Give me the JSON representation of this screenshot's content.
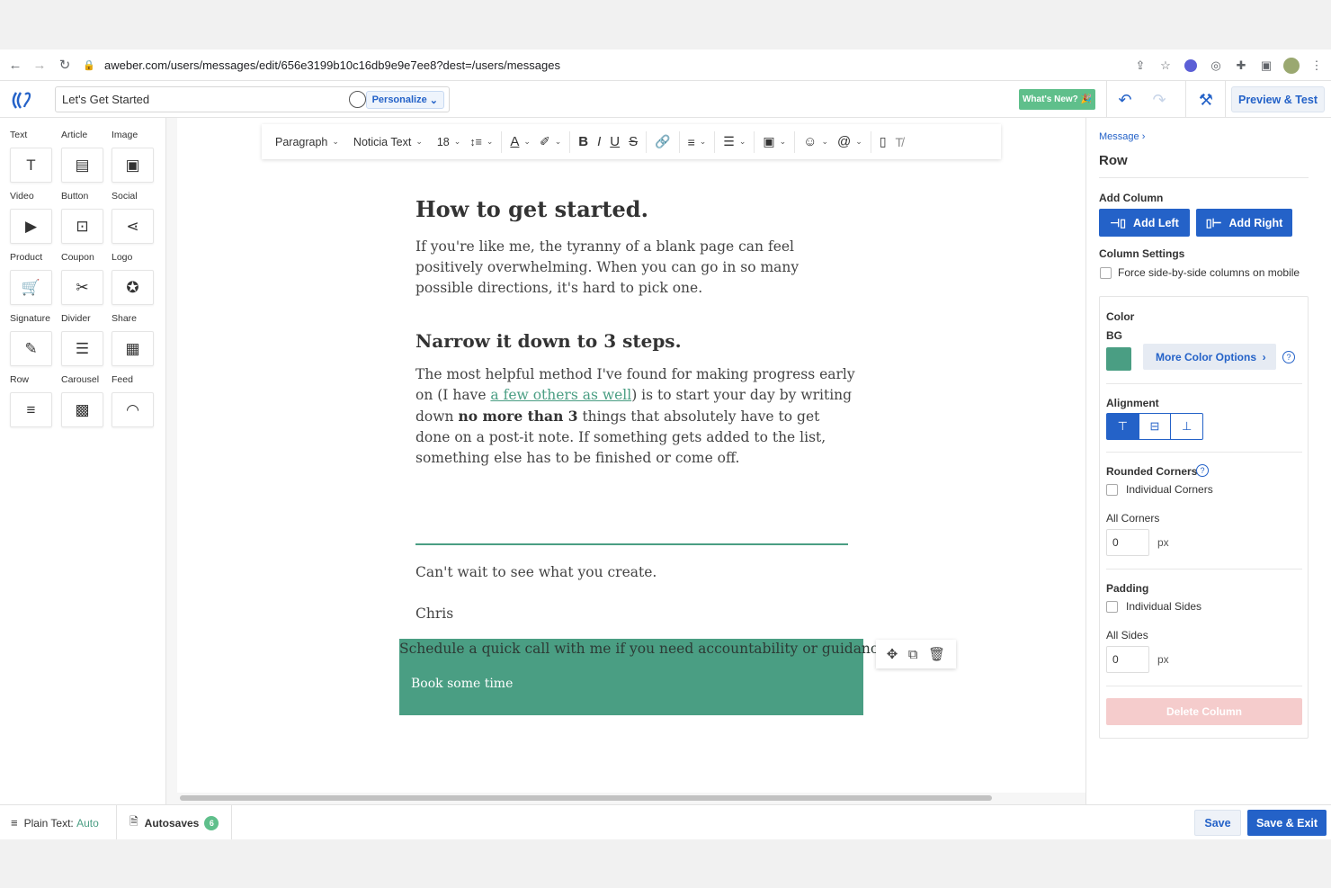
{
  "browser": {
    "url": "aweber.com/users/messages/edit/656e3199b10c16db9e9e7ee8?dest=/users/messages"
  },
  "appbar": {
    "subject_value": "Let's Get Started",
    "personalize_label": "Personalize",
    "whats_new_label": "What's New?",
    "preview_label": "Preview & Test"
  },
  "blocks": [
    {
      "label": "Text",
      "icon": "text-icon",
      "glyph": "T"
    },
    {
      "label": "Article",
      "icon": "article-icon",
      "glyph": "▤"
    },
    {
      "label": "Image",
      "icon": "image-icon",
      "glyph": "▣"
    },
    {
      "label": "Video",
      "icon": "video-icon",
      "glyph": "▶"
    },
    {
      "label": "Button",
      "icon": "button-icon",
      "glyph": "⊡"
    },
    {
      "label": "Social",
      "icon": "social-icon",
      "glyph": "⋖"
    },
    {
      "label": "Product",
      "icon": "product-icon",
      "glyph": "🛒"
    },
    {
      "label": "Coupon",
      "icon": "coupon-icon",
      "glyph": "✂"
    },
    {
      "label": "Logo",
      "icon": "logo-icon",
      "glyph": "✪"
    },
    {
      "label": "Signature",
      "icon": "signature-icon",
      "glyph": "✎"
    },
    {
      "label": "Divider",
      "icon": "divider-icon",
      "glyph": "☰"
    },
    {
      "label": "Share",
      "icon": "share-icon",
      "glyph": "▦"
    },
    {
      "label": "Row",
      "icon": "row-icon",
      "glyph": "≡"
    },
    {
      "label": "Carousel",
      "icon": "carousel-icon",
      "glyph": "▩"
    },
    {
      "label": "Feed",
      "icon": "feed-icon",
      "glyph": "◠"
    }
  ],
  "toolbar": {
    "paragraph": "Paragraph",
    "font": "Noticia Text",
    "size": "18"
  },
  "content": {
    "heading1": "How to get started.",
    "para1": "If you're like me, the tyranny of a blank page can feel positively overwhelming. When you can go in so many possible directions, it's hard to pick one.",
    "heading2": "Narrow it down to 3 steps.",
    "para2_a": "The most helpful method I've found for making progress early on (I have ",
    "para2_link": "a few others as well",
    "para2_b": ") is to start your day by writing down ",
    "para2_bold": "no more than 3",
    "para2_c": " things that absolutely have to get done on a post-it note. If something gets added to the list, something else has to be finished or come off.",
    "closing": "Can't wait to see what you create.",
    "signature": "Chris",
    "row_text": "Schedule a quick call with me if you need accountability or guidance.",
    "row_button": "Book some time"
  },
  "panel": {
    "breadcrumb": "Message",
    "title": "Row",
    "add_column_label": "Add Column",
    "add_left": "Add Left",
    "add_right": "Add Right",
    "column_settings": "Column Settings",
    "force_side_by_side": "Force side-by-side columns on mobile",
    "color_label": "Color",
    "bg_label": "BG",
    "bg_color": "#4a9e83",
    "more_color_options": "More Color Options",
    "alignment_label": "Alignment",
    "rounded_corners": "Rounded Corners",
    "individual_corners": "Individual Corners",
    "all_corners": "All Corners",
    "all_corners_value": "0",
    "px": "px",
    "padding_label": "Padding",
    "individual_sides": "Individual Sides",
    "all_sides": "All Sides",
    "all_sides_value": "0",
    "delete_column": "Delete Column"
  },
  "footer": {
    "plain_text_label": "Plain Text:",
    "plain_text_value": "Auto",
    "autosaves_label": "Autosaves",
    "autosaves_count": "6",
    "save": "Save",
    "save_exit": "Save & Exit"
  },
  "colors": {
    "accent": "#2462c8",
    "green": "#4a9e83",
    "whats_new": "#5fbf8b"
  }
}
